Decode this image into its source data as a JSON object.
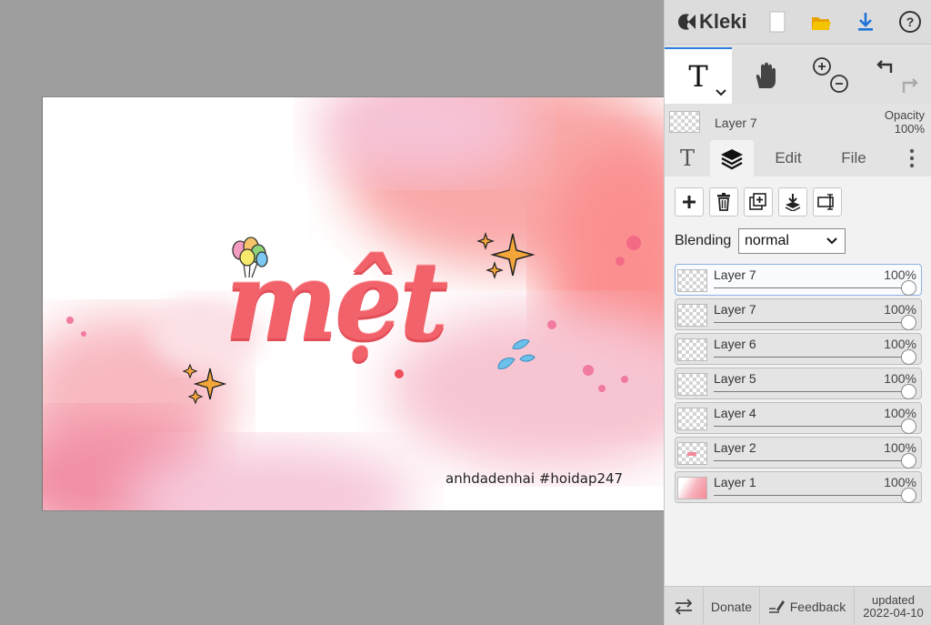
{
  "app": {
    "name": "Kleki",
    "colors": {
      "panel_bg": "#e3e3e3",
      "accent": "#2f7de0",
      "canvas_bg": "#9e9e9e"
    }
  },
  "topbar": {
    "icons": [
      "kleki-logo-icon",
      "new-image-icon",
      "open-folder-icon",
      "download-icon",
      "help-icon"
    ]
  },
  "tools": {
    "active_tool_glyph": "T",
    "items": [
      "text-tool",
      "hand-tool",
      "zoom-in",
      "zoom-out",
      "undo",
      "redo"
    ]
  },
  "current_layer": {
    "name": "Layer 7",
    "opacity_label": "Opacity",
    "opacity_value": "100%"
  },
  "tabs": {
    "text_glyph": "T",
    "edit": "Edit",
    "file": "File"
  },
  "layer_panel": {
    "blending_label": "Blending",
    "blending_value": "normal",
    "layers": [
      {
        "name": "Layer 7",
        "opacity": "100%",
        "selected": true
      },
      {
        "name": "Layer 7",
        "opacity": "100%"
      },
      {
        "name": "Layer 6",
        "opacity": "100%"
      },
      {
        "name": "Layer 5",
        "opacity": "100%"
      },
      {
        "name": "Layer 4",
        "opacity": "100%"
      },
      {
        "name": "Layer 2",
        "opacity": "100%"
      },
      {
        "name": "Layer 1",
        "opacity": "100%"
      }
    ]
  },
  "artwork": {
    "title": "mệt",
    "credit": "anhdadenhai #hoidap247"
  },
  "footer": {
    "donate": "Donate",
    "feedback": "Feedback",
    "updated_label": "updated",
    "updated_date": "2022-04-10"
  }
}
